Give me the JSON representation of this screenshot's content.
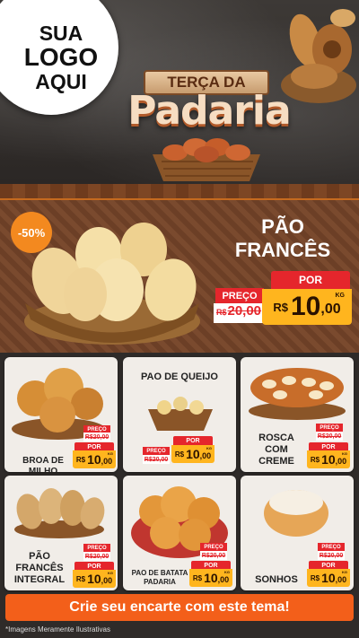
{
  "logo": {
    "line1": "SUA",
    "line2": "LOGO",
    "line3": "AQUI"
  },
  "header": {
    "title_top": "TERÇA DA",
    "title_main": "Padaria"
  },
  "featured": {
    "badge": "-50%",
    "name": "PÃO FRANCÊS",
    "por_label": "POR",
    "preco_label": "PREÇO",
    "old_currency": "R$",
    "old_value": "20,00",
    "new_currency": "R$",
    "new_int": "10",
    "new_dec": ",00",
    "unit": "KG"
  },
  "products": [
    {
      "name": "BROA DE MILHO",
      "preco_label": "PREÇO",
      "old": "R$20,00",
      "por_label": "POR",
      "currency": "R$",
      "int": "10",
      "dec": ",00",
      "unit": "KG"
    },
    {
      "name": "PAO DE QUEIJO",
      "preco_label": "PREÇO",
      "old": "R$20,00",
      "por_label": "POR",
      "currency": "R$",
      "int": "10",
      "dec": ",00",
      "unit": "KG"
    },
    {
      "name": "ROSCA COM CREME",
      "preco_label": "PREÇO",
      "old": "R$20,00",
      "por_label": "POR",
      "currency": "R$",
      "int": "10",
      "dec": ",00",
      "unit": "KG"
    },
    {
      "name": "PÃO FRANCÊS INTEGRAL",
      "preco_label": "PREÇO",
      "old": "R$20,00",
      "por_label": "POR",
      "currency": "R$",
      "int": "10",
      "dec": ",00",
      "unit": "KG"
    },
    {
      "name": "PAO DE BATATA PADARIA",
      "preco_label": "PREÇO",
      "old": "R$20,00",
      "por_label": "POR",
      "currency": "R$",
      "int": "10",
      "dec": ",00",
      "unit": "KG"
    },
    {
      "name": "SONHOS",
      "preco_label": "PREÇO",
      "old": "R$20,00",
      "por_label": "POR",
      "currency": "R$",
      "int": "10",
      "dec": ",00",
      "unit": "KG"
    }
  ],
  "cta": {
    "label": "Crie seu encarte com este tema!"
  },
  "disclaimer": "*Imagens Meramente Ilustrativas",
  "colors": {
    "accent_orange": "#f35f1a",
    "price_yellow": "#ffb51e",
    "tag_red": "#e5262c",
    "wood": "#7a4a2e"
  },
  "icons": [
    "bread-basket-illustration",
    "bread-stack-illustration"
  ]
}
